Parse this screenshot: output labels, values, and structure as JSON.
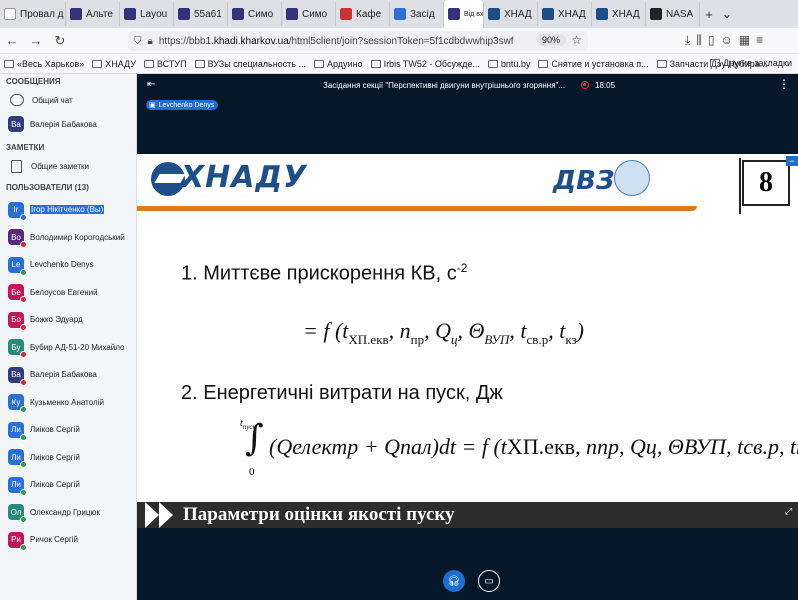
{
  "browser": {
    "tabs": [
      {
        "label": "Провал д",
        "color": "#ffffff",
        "icon": "page-icon"
      },
      {
        "label": "Альте",
        "color": "#33337a",
        "icon": "b-icon"
      },
      {
        "label": "Layou",
        "color": "#33337a",
        "icon": "b-icon"
      },
      {
        "label": "55a61",
        "color": "#33337a",
        "icon": "b-icon"
      },
      {
        "label": "Симо",
        "color": "#33337a",
        "icon": "b-icon"
      },
      {
        "label": "Симо",
        "color": "#33337a",
        "icon": "b-icon"
      },
      {
        "label": "Кафе",
        "color": "#c33",
        "icon": "gift-icon"
      },
      {
        "label": "Засід",
        "color": "#2a6fd6",
        "icon": "lines-icon"
      },
      {
        "label": "Від вхо",
        "color": "#33337a",
        "icon": "b-icon",
        "active": true
      },
      {
        "label": "ХНАД",
        "color": "#1d4f8a",
        "icon": "khnadu-icon"
      },
      {
        "label": "ХНАД",
        "color": "#1d4f8a",
        "icon": "khnadu-icon"
      },
      {
        "label": "ХНАД",
        "color": "#1d4f8a",
        "icon": "khnadu-icon"
      },
      {
        "label": "NASA",
        "color": "#222",
        "icon": "github-icon"
      }
    ],
    "url_prefix": "https://bbb1.",
    "url_domain": "khadi.kharkov.ua",
    "url_suffix": "/html5client/join?sessionToken=5f1cdbdwwhip3swf",
    "zoom": "90%",
    "bookmarks": [
      "«Весь Харьков»",
      "ХНАДУ",
      "ВСТУП",
      "ВУЗы специальность ...",
      "Ардуино",
      "Irbis TW52 - Обсужде...",
      "bntu.by",
      "Снятие и установка п...",
      "Запчасти Дэу Нубира..."
    ],
    "bookmarks_other": "Другие закладки"
  },
  "sidebar": {
    "messages_title": "СООБЩЕНИЯ",
    "public_chat": "Общий чат",
    "private_chat": {
      "initials": "Ва",
      "name": "Валерія Бабакова",
      "color": "#2f3c80"
    },
    "notes_title": "ЗАМЕТКИ",
    "shared_notes": "Общие заметки",
    "users_title": "ПОЛЬЗОВАТЕЛИ (13)",
    "users": [
      {
        "initials": "Ir",
        "name": "Ігор Нікітченко (Вы)",
        "color": "#2a6fd6",
        "badge": "#2a6fd6",
        "selected": true
      },
      {
        "initials": "Во",
        "name": "Володимир Корогодський",
        "color": "#5a2a80",
        "badge": "#d23"
      },
      {
        "initials": "Le",
        "name": "Levchenko Denys",
        "color": "#2a6fd6",
        "badge": "#2a9d4a"
      },
      {
        "initials": "Бе",
        "name": "Белоусов Евгений",
        "color": "#c2185b",
        "badge": "#d23"
      },
      {
        "initials": "Бо",
        "name": "Божко Эдуард",
        "color": "#c2185b",
        "badge": "#d23"
      },
      {
        "initials": "Бу",
        "name": "Бубир АД-51-20 Михайло",
        "color": "#2a8a7a",
        "badge": "#d23"
      },
      {
        "initials": "Ва",
        "name": "Валерія Бабакова",
        "color": "#2f3c80",
        "badge": "#d23"
      },
      {
        "initials": "Ку",
        "name": "Кузьменко Анатолій",
        "color": "#2a6fd6",
        "badge": "#2a9d4a"
      },
      {
        "initials": "Ли",
        "name": "Лиіков Сергій",
        "color": "#2a6fd6",
        "badge": "#2a9d4a"
      },
      {
        "initials": "Ли",
        "name": "Лиіков Сергій",
        "color": "#2a6fd6",
        "badge": "#2a9d4a"
      },
      {
        "initials": "Ли",
        "name": "Лиіков Сергій",
        "color": "#2a6fd6",
        "badge": "#2a9d4a"
      },
      {
        "initials": "Ол",
        "name": "Олександр Грицюк",
        "color": "#2a8a7a",
        "badge": "#2a9d4a"
      },
      {
        "initials": "Ри",
        "name": "Ричок Сергій",
        "color": "#c2185b",
        "badge": "#2a9d4a"
      }
    ]
  },
  "meeting": {
    "title": "Засідання секції \"Перспективні двигуни внутрішнього згоряння\"...",
    "rec_time": "18:05",
    "presenter": "Levchenko Denys"
  },
  "slide": {
    "logo_text": "ХНАДУ",
    "dvz_text": "ДВЗ",
    "page_number": "8",
    "heading1": "1. Миттєве прискорення КВ, с",
    "heading1_exp": "-2",
    "heading2": "2. Енергетичні витрати на пуск, Дж",
    "footer_text": "Параметри оцінки якості пуску"
  }
}
